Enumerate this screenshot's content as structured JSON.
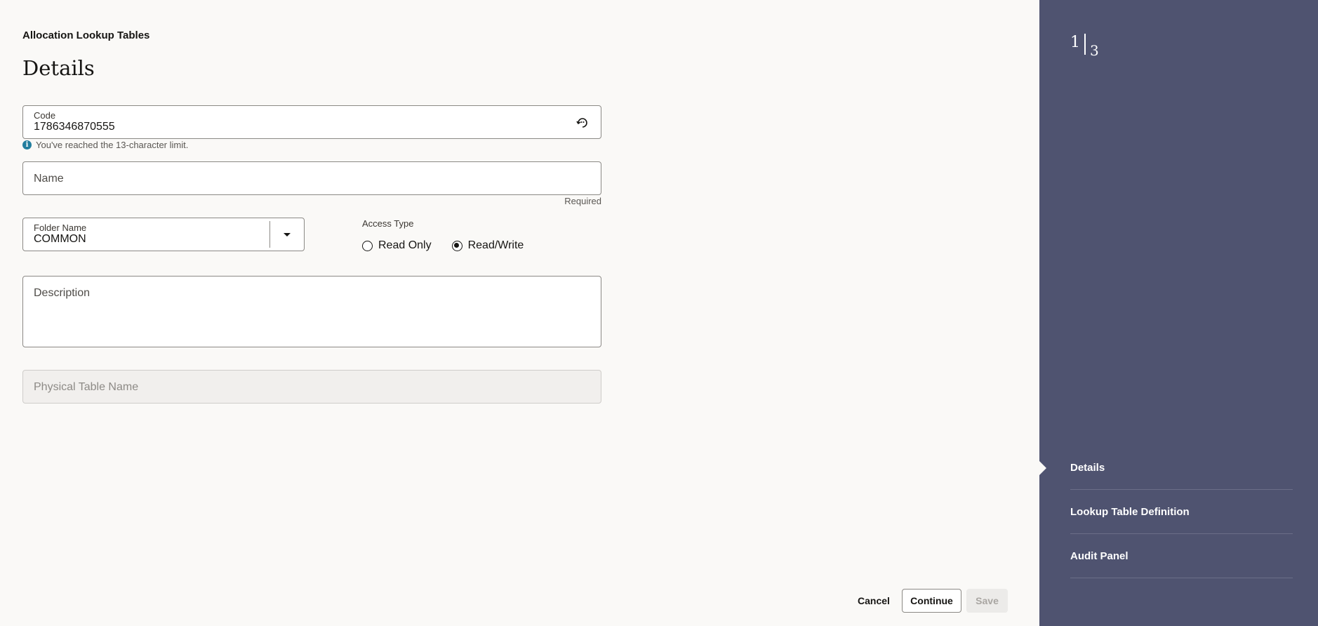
{
  "breadcrumb": "Allocation Lookup Tables",
  "title": "Details",
  "code": {
    "label": "Code",
    "value": "1786346870555",
    "hint": "You've reached the 13-character limit.",
    "hint_icon": "info-icon",
    "action_icon": "refresh-icon"
  },
  "name": {
    "placeholder": "Name",
    "required_text": "Required"
  },
  "folder": {
    "label": "Folder Name",
    "value": "COMMON",
    "dropdown_icon": "chevron-down-icon"
  },
  "access_type": {
    "label": "Access Type",
    "options": [
      {
        "label": "Read Only",
        "checked": false
      },
      {
        "label": "Read/Write",
        "checked": true
      }
    ]
  },
  "description": {
    "placeholder": "Description"
  },
  "physical_table": {
    "placeholder": "Physical Table Name",
    "disabled": true
  },
  "footer": {
    "cancel_label": "Cancel",
    "continue_label": "Continue",
    "save_label": "Save"
  },
  "sidebar": {
    "step_current": "1",
    "step_total": "3",
    "steps": [
      {
        "label": "Details",
        "active": true
      },
      {
        "label": "Lookup Table Definition",
        "active": false
      },
      {
        "label": "Audit Panel",
        "active": false
      }
    ],
    "colors": {
      "background": "#4f5370",
      "text": "#ffffff"
    }
  }
}
